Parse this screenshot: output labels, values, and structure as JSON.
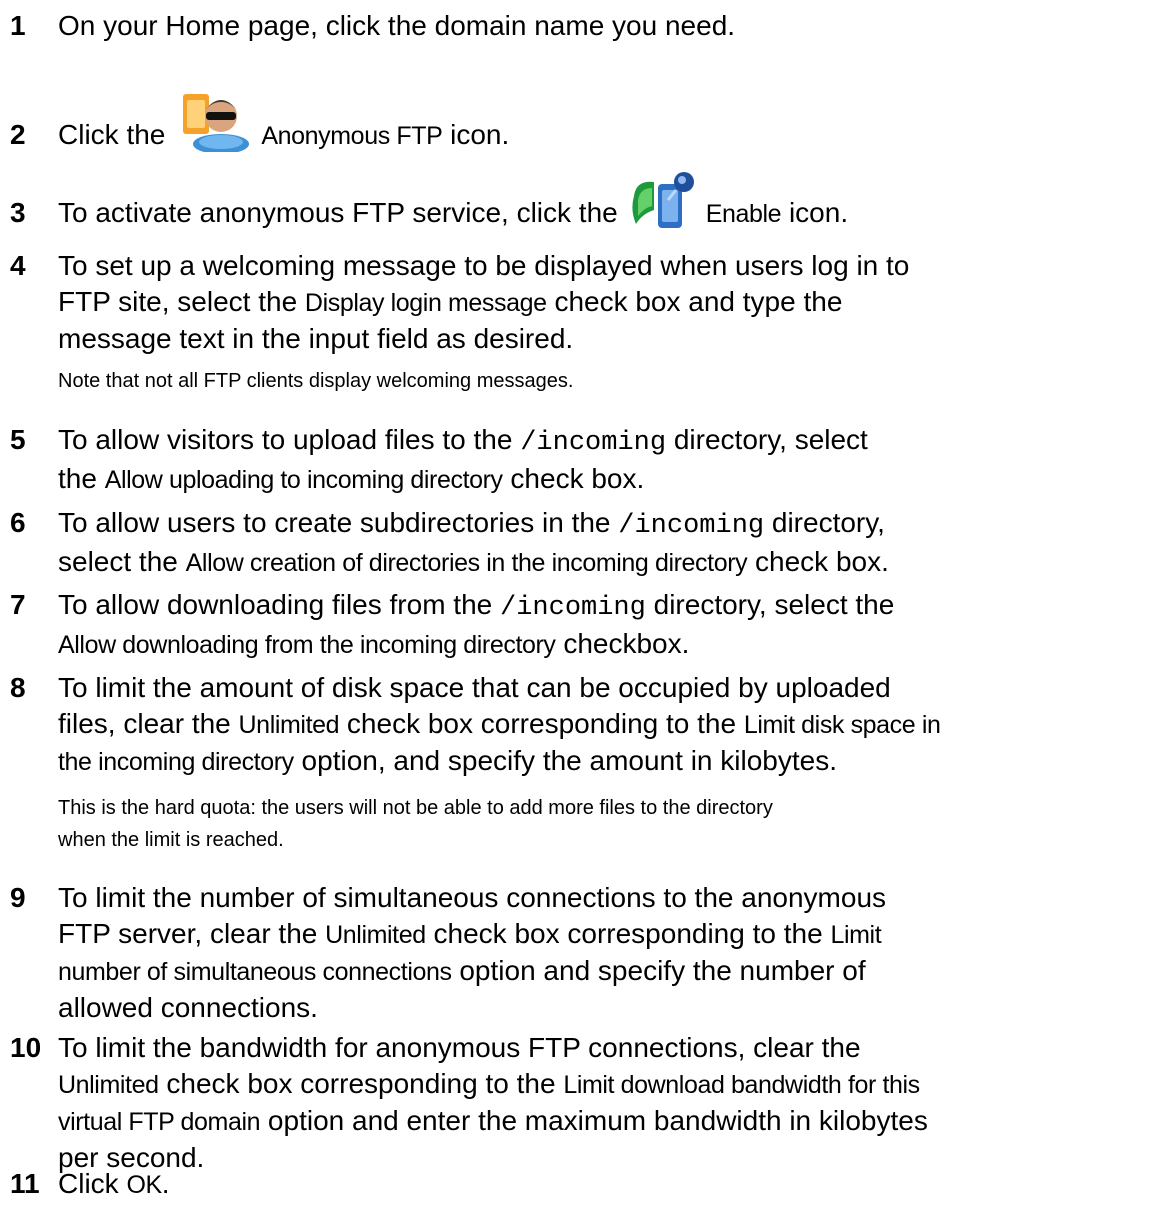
{
  "steps": [
    {
      "num": "1",
      "text": "On your Home page, click the domain name you need."
    },
    {
      "num": "2",
      "pre": "Click the",
      "ui": "Anonymous FTP",
      "post": "icon.",
      "icon": "anonymous-ftp-user-icon"
    },
    {
      "num": "3",
      "pre": "To activate anonymous FTP service, click the",
      "ui": "Enable",
      "post": "icon.",
      "icon": "enable-icon"
    },
    {
      "num": "4",
      "l1": "To set up a welcoming message to be displayed when users log in to",
      "l2a": "FTP site, select the",
      "l2ui": "Display login message",
      "l2b": "check box and type the",
      "l3": "message text in the input field as desired."
    },
    {
      "num": "5",
      "l1a": "To allow visitors to upload files to the",
      "l1code": "/incoming",
      "l1b": "directory, select",
      "l2a": "the",
      "l2ui": "Allow uploading to incoming directory",
      "l2b": "check box."
    },
    {
      "num": "6",
      "l1a": "To allow users to create subdirectories in the",
      "l1code": "/incoming",
      "l1b": "directory,",
      "l2a": "select the",
      "l2ui": "Allow creation of directories in the incoming directory",
      "l2b": "check box."
    },
    {
      "num": "7",
      "l1a": "To allow downloading files from the",
      "l1code": "/incoming",
      "l1b": "directory, select the",
      "l2ui": "Allow downloading from the incoming directory",
      "l2b": "checkbox."
    },
    {
      "num": "8",
      "l1": "To limit the amount of disk space that can be occupied by uploaded",
      "l2a": "files, clear the",
      "l2ui1": "Unlimited",
      "l2b": "check box corresponding to the",
      "l2ui2": "Limit disk space in",
      "l3ui": "the incoming directory",
      "l3b": "option, and specify the amount in kilobytes."
    },
    {
      "num": "9",
      "l1": "To limit the number of simultaneous connections to the anonymous",
      "l2a": "FTP server, clear the",
      "l2ui1": "Unlimited",
      "l2b": "check box corresponding to the",
      "l2ui2": "Limit",
      "l3ui": "number of simultaneous connections",
      "l3b": "option and specify the number of",
      "l4": "allowed connections."
    },
    {
      "num": "10",
      "l1": "To limit the bandwidth for anonymous FTP connections, clear the",
      "l2ui1": "Unlimited",
      "l2b": "check box corresponding to the",
      "l2ui2": "Limit download bandwidth for this",
      "l3ui": "virtual FTP domain",
      "l3b": "option and enter the maximum bandwidth in kilobytes",
      "l4": "per second."
    },
    {
      "num": "11",
      "pre": "Click",
      "ui": "OK",
      "post": "."
    }
  ],
  "notes": {
    "note4": "Note that not all FTP clients display welcoming messages.",
    "note8_l1": "This is the hard quota: the users will not be able to add more files to the directory",
    "note8_l2": "when the limit is reached."
  }
}
